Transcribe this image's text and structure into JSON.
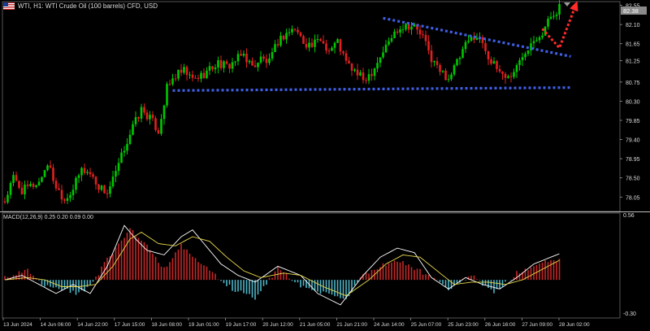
{
  "header": {
    "title": "WTI, H1:  WTI Crude Oil (100 barrels) CFD, USD",
    "flag_icon": "us-flag-icon"
  },
  "macd": {
    "label": "MACD(12,26,9) 0.25 0.20 0.09 0.00",
    "axis_top": "0.56",
    "axis_bottom": "-0.30"
  },
  "colors": {
    "background": "#000000",
    "bull_candle": "#00c800",
    "bear_candle": "#e02020",
    "trend_line": "#3f5fe6",
    "forecast_arrow": "#ff2a2a",
    "macd_positive": "#c62828",
    "macd_negative": "#4db6c8",
    "macd_line": "#ffffff",
    "signal_line": "#e8d84a",
    "price_label_bg": "#8a8a8a"
  },
  "chart_data": [
    {
      "type": "candlestick",
      "symbol": "WTI",
      "timeframe": "H1",
      "y_ticks": [
        "82.55",
        "82.10",
        "81.65",
        "81.25",
        "80.75",
        "80.30",
        "79.85",
        "79.40",
        "78.95",
        "78.50",
        "78.05"
      ],
      "ylim": [
        77.75,
        82.58
      ],
      "current_price": "82.38",
      "x_ticks": [
        "13 Jun 2024",
        "14 Jun 06:00",
        "14 Jun 22:00",
        "17 Jun 15:00",
        "18 Jun 08:00",
        "19 Jun 01:00",
        "19 Jun 17:00",
        "20 Jun 12:00",
        "21 Jun 05:00",
        "21 Jun 21:00",
        "24 Jun 14:00",
        "25 Jun 07:00",
        "25 Jun 23:00",
        "26 Jun 16:00",
        "27 Jun 09:00",
        "28 Jun 02:00"
      ],
      "close_path": [
        [
          0,
          77.95
        ],
        [
          3,
          78.5
        ],
        [
          6,
          78.2
        ],
        [
          9,
          78.3
        ],
        [
          12,
          78.4
        ],
        [
          15,
          78.85
        ],
        [
          18,
          78.3
        ],
        [
          21,
          78.0
        ],
        [
          24,
          78.25
        ],
        [
          27,
          78.7
        ],
        [
          30,
          78.6
        ],
        [
          33,
          78.3
        ],
        [
          36,
          78.15
        ],
        [
          39,
          78.6
        ],
        [
          42,
          79.2
        ],
        [
          45,
          79.7
        ],
        [
          48,
          80.1
        ],
        [
          51,
          79.9
        ],
        [
          54,
          79.6
        ],
        [
          57,
          80.6
        ],
        [
          60,
          80.9
        ],
        [
          63,
          81.0
        ],
        [
          66,
          80.8
        ],
        [
          69,
          80.9
        ],
        [
          72,
          81.05
        ],
        [
          75,
          81.2
        ],
        [
          78,
          81.1
        ],
        [
          81,
          81.25
        ],
        [
          84,
          81.4
        ],
        [
          87,
          81.1
        ],
        [
          90,
          81.3
        ],
        [
          93,
          81.2
        ],
        [
          96,
          81.7
        ],
        [
          99,
          81.9
        ],
        [
          102,
          82.0
        ],
        [
          105,
          81.7
        ],
        [
          108,
          81.6
        ],
        [
          111,
          81.75
        ],
        [
          114,
          81.5
        ],
        [
          117,
          81.7
        ],
        [
          120,
          81.2
        ],
        [
          123,
          81.0
        ],
        [
          126,
          80.8
        ],
        [
          129,
          81.0
        ],
        [
          132,
          81.35
        ],
        [
          135,
          81.7
        ],
        [
          138,
          82.0
        ],
        [
          141,
          82.1
        ],
        [
          144,
          82.05
        ],
        [
          147,
          81.8
        ],
        [
          150,
          81.3
        ],
        [
          153,
          81.0
        ],
        [
          156,
          80.85
        ],
        [
          159,
          81.2
        ],
        [
          162,
          81.6
        ],
        [
          165,
          81.85
        ],
        [
          168,
          81.7
        ],
        [
          171,
          81.2
        ],
        [
          174,
          81.0
        ],
        [
          177,
          80.85
        ],
        [
          180,
          81.1
        ],
        [
          183,
          81.5
        ],
        [
          186,
          81.8
        ],
        [
          189,
          81.9
        ],
        [
          192,
          82.3
        ],
        [
          195,
          82.5
        ]
      ],
      "annotations": [
        {
          "type": "dotted-line",
          "name": "support",
          "points": [
            [
              59,
              80.55
            ],
            [
              199,
              80.62
            ]
          ]
        },
        {
          "type": "dotted-line",
          "name": "resistance",
          "points": [
            [
              133,
              82.25
            ],
            [
              199,
              81.35
            ]
          ]
        },
        {
          "type": "dotted-arrow",
          "name": "forecast",
          "points": [
            [
              189,
              82.0
            ],
            [
              195,
              81.55
            ],
            [
              201,
              82.6
            ]
          ]
        }
      ]
    },
    {
      "type": "macd",
      "name": "MACD(12,26,9)",
      "params": [
        12,
        26,
        9
      ],
      "values": [
        "0.25",
        "0.20",
        "0.09",
        "0.00"
      ],
      "ylim": [
        -0.3,
        0.56
      ],
      "y_ticks": [
        "0.56",
        "-0.30"
      ],
      "histogram_path": [
        [
          0,
          0.02
        ],
        [
          8,
          0.08
        ],
        [
          13,
          -0.05
        ],
        [
          20,
          -0.08
        ],
        [
          25,
          -0.12
        ],
        [
          30,
          -0.06
        ],
        [
          36,
          0.18
        ],
        [
          44,
          0.45
        ],
        [
          50,
          0.3
        ],
        [
          56,
          0.1
        ],
        [
          62,
          0.3
        ],
        [
          70,
          0.12
        ],
        [
          80,
          -0.08
        ],
        [
          88,
          -0.16
        ],
        [
          96,
          0.1
        ],
        [
          104,
          -0.05
        ],
        [
          112,
          -0.12
        ],
        [
          120,
          -0.18
        ],
        [
          126,
          0.05
        ],
        [
          132,
          0.12
        ],
        [
          137,
          0.18
        ],
        [
          146,
          0.08
        ],
        [
          156,
          -0.08
        ],
        [
          164,
          0.04
        ],
        [
          172,
          -0.12
        ],
        [
          180,
          0.06
        ],
        [
          188,
          0.15
        ],
        [
          195,
          0.18
        ]
      ],
      "macd_line_path": [
        [
          0,
          0.0
        ],
        [
          6,
          0.04
        ],
        [
          12,
          -0.04
        ],
        [
          18,
          -0.12
        ],
        [
          24,
          -0.04
        ],
        [
          30,
          -0.12
        ],
        [
          36,
          0.12
        ],
        [
          42,
          0.48
        ],
        [
          46,
          0.36
        ],
        [
          50,
          0.26
        ],
        [
          56,
          0.22
        ],
        [
          62,
          0.38
        ],
        [
          66,
          0.44
        ],
        [
          70,
          0.32
        ],
        [
          76,
          0.14
        ],
        [
          82,
          0.04
        ],
        [
          88,
          -0.02
        ],
        [
          96,
          0.12
        ],
        [
          104,
          0.04
        ],
        [
          110,
          -0.12
        ],
        [
          118,
          -0.22
        ],
        [
          126,
          0.04
        ],
        [
          132,
          0.2
        ],
        [
          138,
          0.28
        ],
        [
          144,
          0.24
        ],
        [
          150,
          0.02
        ],
        [
          156,
          -0.08
        ],
        [
          162,
          0.02
        ],
        [
          168,
          -0.04
        ],
        [
          174,
          -0.08
        ],
        [
          180,
          0.02
        ],
        [
          186,
          0.14
        ],
        [
          192,
          0.2
        ],
        [
          197,
          0.25
        ]
      ],
      "signal_line_path": [
        [
          0,
          0.0
        ],
        [
          8,
          0.02
        ],
        [
          14,
          0.0
        ],
        [
          20,
          -0.06
        ],
        [
          26,
          -0.06
        ],
        [
          32,
          -0.04
        ],
        [
          38,
          0.12
        ],
        [
          44,
          0.36
        ],
        [
          48,
          0.42
        ],
        [
          54,
          0.32
        ],
        [
          60,
          0.3
        ],
        [
          66,
          0.38
        ],
        [
          72,
          0.34
        ],
        [
          78,
          0.2
        ],
        [
          84,
          0.08
        ],
        [
          90,
          0.02
        ],
        [
          98,
          0.06
        ],
        [
          104,
          0.04
        ],
        [
          112,
          -0.06
        ],
        [
          120,
          -0.14
        ],
        [
          128,
          0.0
        ],
        [
          134,
          0.14
        ],
        [
          140,
          0.22
        ],
        [
          146,
          0.2
        ],
        [
          152,
          0.08
        ],
        [
          158,
          -0.04
        ],
        [
          164,
          -0.02
        ],
        [
          170,
          -0.02
        ],
        [
          176,
          -0.04
        ],
        [
          182,
          0.0
        ],
        [
          188,
          0.08
        ],
        [
          194,
          0.16
        ],
        [
          197,
          0.2
        ]
      ]
    }
  ]
}
